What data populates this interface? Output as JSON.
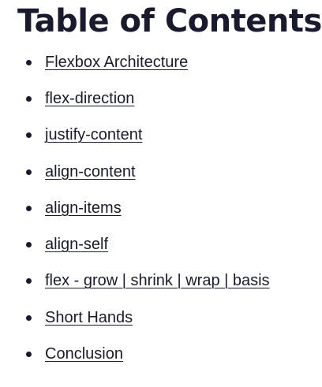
{
  "toc": {
    "title": "Table of Contents",
    "items": [
      {
        "label": "Flexbox Architecture"
      },
      {
        "label": "flex-direction"
      },
      {
        "label": "justify-content"
      },
      {
        "label": "align-content"
      },
      {
        "label": "align-items"
      },
      {
        "label": "align-self"
      },
      {
        "label": "flex - grow | shrink | wrap | basis"
      },
      {
        "label": "Short Hands"
      },
      {
        "label": "Conclusion"
      }
    ]
  },
  "colors": {
    "text": "#1a1a2e",
    "background": "#ffffff"
  }
}
